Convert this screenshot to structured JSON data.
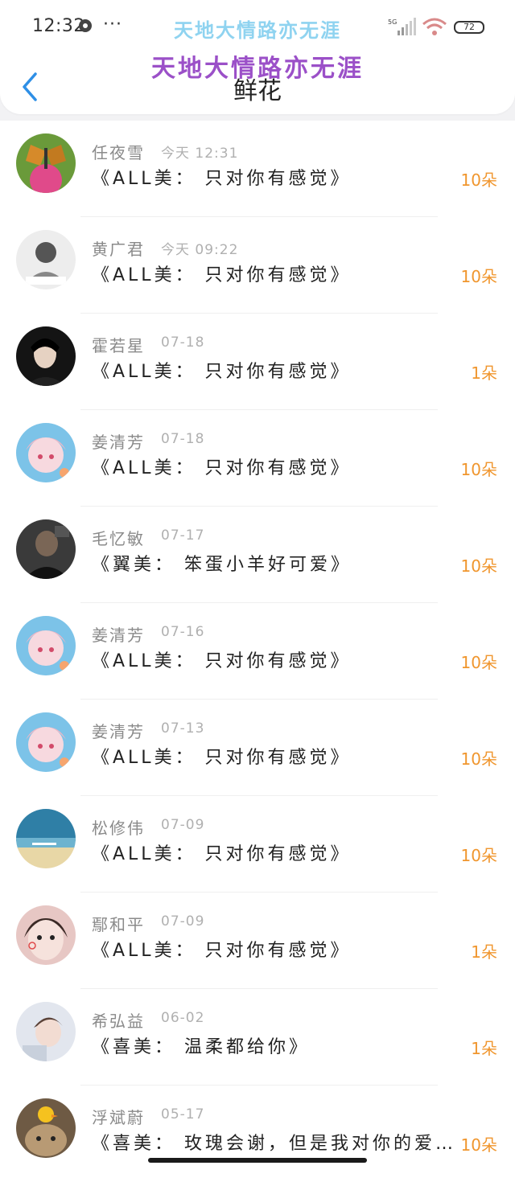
{
  "status_bar": {
    "time": "12:32",
    "dots": "···",
    "network": "5G",
    "battery": "72"
  },
  "overlay": {
    "top_text": "天地大情路亦无涯",
    "main_text": "天地大情路亦无涯"
  },
  "header": {
    "title": "鲜花"
  },
  "colors": {
    "accent": "#f0962e",
    "back_icon": "#2e8fe6",
    "overlay_purple": "#9b50c8",
    "overlay_blue": "#8fd3f0"
  },
  "items": [
    {
      "name": "任夜雪",
      "date": "今天 12:31",
      "book": "《ALL美： 只对你有感觉》",
      "count": "10朵",
      "avatar": "butterfly-avatar"
    },
    {
      "name": "黄广君",
      "date": "今天 09:22",
      "book": "《ALL美： 只对你有感觉》",
      "count": "10朵",
      "avatar": "person-sketch-avatar"
    },
    {
      "name": "霍若星",
      "date": "07-18",
      "book": "《ALL美： 只对你有感觉》",
      "count": "1朵",
      "avatar": "dark-portrait-avatar"
    },
    {
      "name": "姜清芳",
      "date": "07-18",
      "book": "《ALL美： 只对你有感觉》",
      "count": "10朵",
      "avatar": "anime-girl-avatar"
    },
    {
      "name": "毛忆敏",
      "date": "07-17",
      "book": "《翼美： 笨蛋小羊好可爱》",
      "count": "10朵",
      "avatar": "dark-person-avatar"
    },
    {
      "name": "姜清芳",
      "date": "07-16",
      "book": "《ALL美： 只对你有感觉》",
      "count": "10朵",
      "avatar": "anime-girl-avatar"
    },
    {
      "name": "姜清芳",
      "date": "07-13",
      "book": "《ALL美： 只对你有感觉》",
      "count": "10朵",
      "avatar": "anime-girl-avatar"
    },
    {
      "name": "松修伟",
      "date": "07-09",
      "book": "《ALL美： 只对你有感觉》",
      "count": "10朵",
      "avatar": "beach-avatar"
    },
    {
      "name": "鄢和平",
      "date": "07-09",
      "book": "《ALL美： 只对你有感觉》",
      "count": "1朵",
      "avatar": "girl-face-avatar"
    },
    {
      "name": "希弘益",
      "date": "06-02",
      "book": "《喜美： 温柔都给你》",
      "count": "1朵",
      "avatar": "boy-avatar"
    },
    {
      "name": "浮斌蔚",
      "date": "05-17",
      "book": "《喜美： 玫瑰会谢，但是我对你的爱…",
      "count": "10朵",
      "avatar": "cat-duck-avatar"
    }
  ]
}
